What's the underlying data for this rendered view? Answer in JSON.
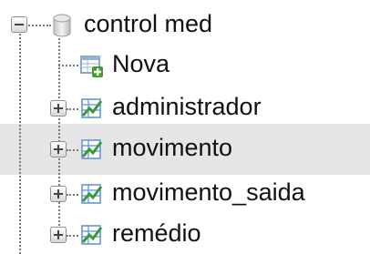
{
  "header_fragment": "",
  "tree": {
    "database": {
      "label": "control med",
      "expanded": true
    },
    "nodes": [
      {
        "label": "Nova",
        "type": "new"
      },
      {
        "label": "administrador",
        "type": "table",
        "expanded": false
      },
      {
        "label": "movimento",
        "type": "table",
        "expanded": false,
        "highlighted": true
      },
      {
        "label": "movimento_saida",
        "type": "table",
        "expanded": false
      },
      {
        "label": "remédio",
        "type": "table",
        "expanded": false
      }
    ]
  },
  "colors": {
    "highlight": "#e6e6e6",
    "table_icon_green": "#3a9a3a",
    "table_icon_blue": "#5b8fd6"
  },
  "icons": [
    "collapse-icon",
    "database-icon",
    "new-table-icon",
    "expand-icon",
    "table-icon"
  ]
}
